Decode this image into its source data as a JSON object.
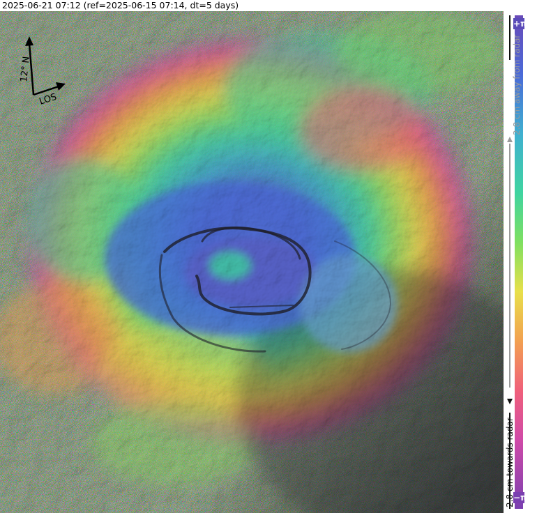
{
  "title": "2025-06-21 07:12 (ref=2025-06-15 07:14, dt=5 days)",
  "orientation": {
    "north_label": "12° N",
    "los_label": "LOS"
  },
  "colorbar": {
    "top_label": "+π",
    "bottom_label": "−π",
    "upper_text": "2.8 cm away from radar",
    "lower_text": "2.8 cm towards radar",
    "colors": [
      "#7a3fb0",
      "#d04aa8",
      "#f0607a",
      "#f2a050",
      "#e8e04a",
      "#7ee060",
      "#3fd4a0",
      "#3fb0d0",
      "#4a6ad8",
      "#6a4ab8"
    ]
  }
}
